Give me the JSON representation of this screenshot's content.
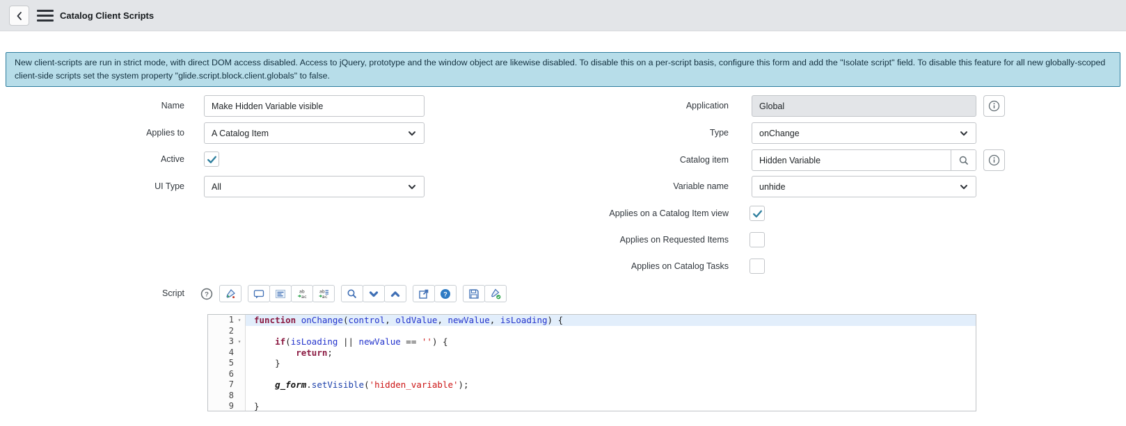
{
  "header": {
    "title": "Catalog Client Scripts"
  },
  "banner": {
    "text": "New client-scripts are run in strict mode, with direct DOM access disabled. Access to jQuery, prototype and the window object are likewise disabled. To disable this on a per-script basis, configure this form and add the \"Isolate script\" field. To disable this feature for all new globally-scoped client-side scripts set the system property \"glide.script.block.client.globals\" to false.",
    "background": "#b7dde9",
    "border_color": "#2e7d9e"
  },
  "form": {
    "left": {
      "name": {
        "label": "Name",
        "value": "Make Hidden Variable visible"
      },
      "applies_to": {
        "label": "Applies to",
        "value": "A Catalog Item"
      },
      "active": {
        "label": "Active",
        "checked": true
      },
      "ui_type": {
        "label": "UI Type",
        "value": "All"
      }
    },
    "right": {
      "application": {
        "label": "Application",
        "value": "Global",
        "readonly": true
      },
      "type": {
        "label": "Type",
        "value": "onChange"
      },
      "catalog_item": {
        "label": "Catalog item",
        "value": "Hidden Variable"
      },
      "variable_name": {
        "label": "Variable name",
        "value": "unhide"
      },
      "applies_catalog_item_view": {
        "label": "Applies on a Catalog Item view",
        "checked": true
      },
      "applies_requested_items": {
        "label": "Applies on Requested Items",
        "checked": false
      },
      "applies_catalog_tasks": {
        "label": "Applies on Catalog Tasks",
        "checked": false
      }
    },
    "check_color": "#2e7f9e"
  },
  "script": {
    "label": "Script",
    "toolbar": {
      "standalone_icon": "context-help-icon",
      "groups": [
        [
          "syntax-highlight"
        ],
        [
          "toggle-comment",
          "format-code",
          "replace",
          "replace-all"
        ],
        [
          "search",
          "find-next",
          "find-previous"
        ],
        [
          "open-window",
          "help"
        ],
        [
          "save",
          "syntax-check"
        ]
      ]
    },
    "editor": {
      "active_line": 1,
      "lines": [
        {
          "num": 1,
          "fold": true,
          "active": true,
          "tokens": [
            {
              "t": "function",
              "y": "kw"
            },
            {
              "t": " ",
              "y": "plain"
            },
            {
              "t": "onChange",
              "y": "id"
            },
            {
              "t": "(",
              "y": "plain"
            },
            {
              "t": "control",
              "y": "id"
            },
            {
              "t": ", ",
              "y": "plain"
            },
            {
              "t": "oldValue",
              "y": "id"
            },
            {
              "t": ", ",
              "y": "plain"
            },
            {
              "t": "newValue",
              "y": "id"
            },
            {
              "t": ", ",
              "y": "plain"
            },
            {
              "t": "isLoading",
              "y": "id"
            },
            {
              "t": ") {",
              "y": "plain"
            }
          ]
        },
        {
          "num": 2,
          "fold": false,
          "active": false,
          "tokens": []
        },
        {
          "num": 3,
          "fold": true,
          "active": false,
          "tokens": [
            {
              "t": "    ",
              "y": "plain"
            },
            {
              "t": "if",
              "y": "kw"
            },
            {
              "t": "(",
              "y": "plain"
            },
            {
              "t": "isLoading",
              "y": "id"
            },
            {
              "t": " || ",
              "y": "plain"
            },
            {
              "t": "newValue",
              "y": "id"
            },
            {
              "t": " == ",
              "y": "plain"
            },
            {
              "t": "''",
              "y": "str"
            },
            {
              "t": ") {",
              "y": "plain"
            }
          ]
        },
        {
          "num": 4,
          "fold": false,
          "active": false,
          "tokens": [
            {
              "t": "        ",
              "y": "plain"
            },
            {
              "t": "return",
              "y": "kw"
            },
            {
              "t": ";",
              "y": "plain"
            }
          ]
        },
        {
          "num": 5,
          "fold": false,
          "active": false,
          "tokens": [
            {
              "t": "    }",
              "y": "plain"
            }
          ]
        },
        {
          "num": 6,
          "fold": false,
          "active": false,
          "tokens": []
        },
        {
          "num": 7,
          "fold": false,
          "active": false,
          "tokens": [
            {
              "t": "    ",
              "y": "plain"
            },
            {
              "t": "g_form",
              "y": "global"
            },
            {
              "t": ".",
              "y": "plain"
            },
            {
              "t": "setVisible",
              "y": "prop"
            },
            {
              "t": "(",
              "y": "plain"
            },
            {
              "t": "'hidden_variable'",
              "y": "str"
            },
            {
              "t": ");",
              "y": "plain"
            }
          ]
        },
        {
          "num": 8,
          "fold": false,
          "active": false,
          "tokens": []
        },
        {
          "num": 9,
          "fold": false,
          "active": false,
          "tokens": [
            {
              "t": "}",
              "y": "plain"
            }
          ]
        }
      ]
    }
  }
}
